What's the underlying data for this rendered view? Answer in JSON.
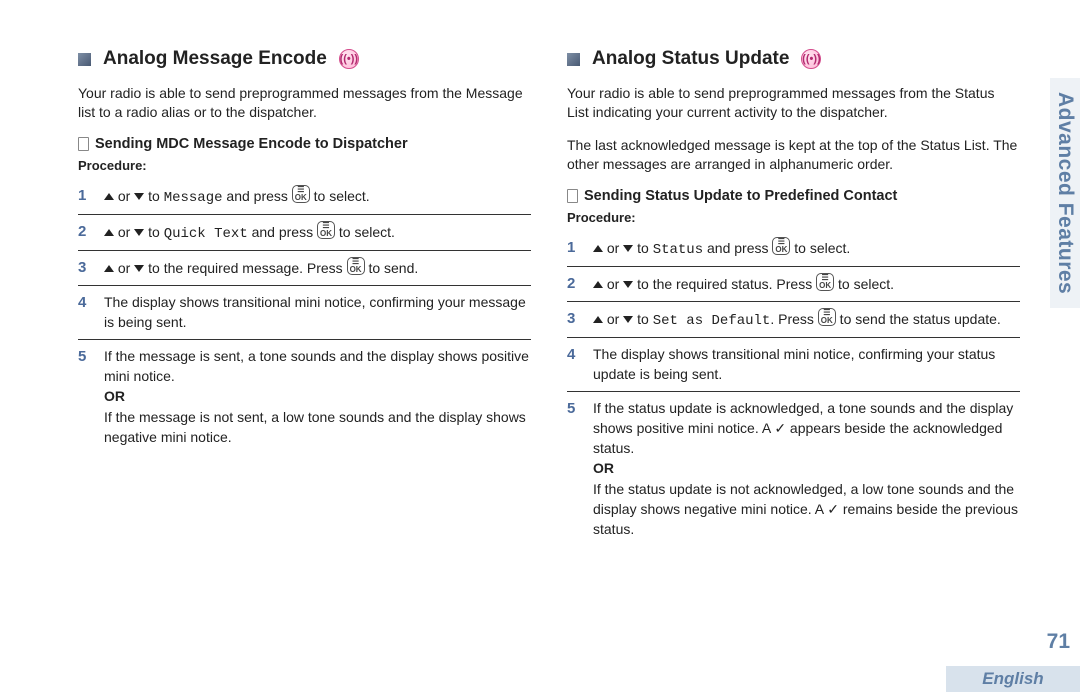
{
  "sideTab": "Advanced Features",
  "pageNumber": "71",
  "language": "English",
  "left": {
    "heading": "Analog Message Encode",
    "iconGlyph": "((•))",
    "intro": "Your radio is able to send preprogrammed messages from the Message list to a radio alias or to the dispatcher.",
    "subHeading": "Sending MDC Message Encode to Dispatcher",
    "procedureLabel": "Procedure:",
    "steps": {
      "s1_pre": " or ",
      "s1_mid": " to ",
      "s1_code": "Message",
      "s1_post1": " and press ",
      "s1_post2": " to select.",
      "s2_pre": " or ",
      "s2_mid": " to ",
      "s2_code": "Quick Text",
      "s2_post1": " and press ",
      "s2_post2": " to select.",
      "s3_pre": " or ",
      "s3_mid": " to the required message. Press ",
      "s3_post": " to send.",
      "s4": " The display shows transitional mini notice, confirming your message is being sent.",
      "s5a": "If the message is sent, a tone sounds and the display shows positive mini notice.",
      "s5or": "OR",
      "s5b": "If the message is not sent, a low tone sounds and the display shows negative mini notice."
    }
  },
  "right": {
    "heading": "Analog Status Update",
    "iconGlyph": "((•))",
    "intro1": "Your radio is able to send preprogrammed messages from the Status List indicating your current activity to the dispatcher.",
    "intro2": "The last acknowledged message is kept at the top of the Status List. The other messages are arranged in alphanumeric order.",
    "subHeading": "Sending Status Update to Predefined Contact",
    "procedureLabel": "Procedure:",
    "steps": {
      "s1_pre": " or ",
      "s1_mid": " to ",
      "s1_code": "Status",
      "s1_post1": " and press ",
      "s1_post2": " to select.",
      "s2_pre": " or ",
      "s2_mid": " to the required status. Press ",
      "s2_post": " to select.",
      "s3_pre": " or ",
      "s3_mid": " to ",
      "s3_code": "Set as Default",
      "s3_post1": ". Press ",
      "s3_post2": " to send the status update.",
      "s4": "The display shows transitional mini notice, confirming your status update is being sent.",
      "s5a_a": "If the status update is acknowledged, a tone sounds and the display shows positive mini notice. A ",
      "s5a_b": " appears beside the acknowledged status.",
      "s5or": "OR",
      "s5b_a": "If the status update is not acknowledged, a low tone sounds and the display shows negative mini notice. A ",
      "s5b_b": " remains beside the previous status."
    }
  },
  "keys": {
    "ok_top": "☰",
    "ok_bot": "OK",
    "check": "✓"
  }
}
